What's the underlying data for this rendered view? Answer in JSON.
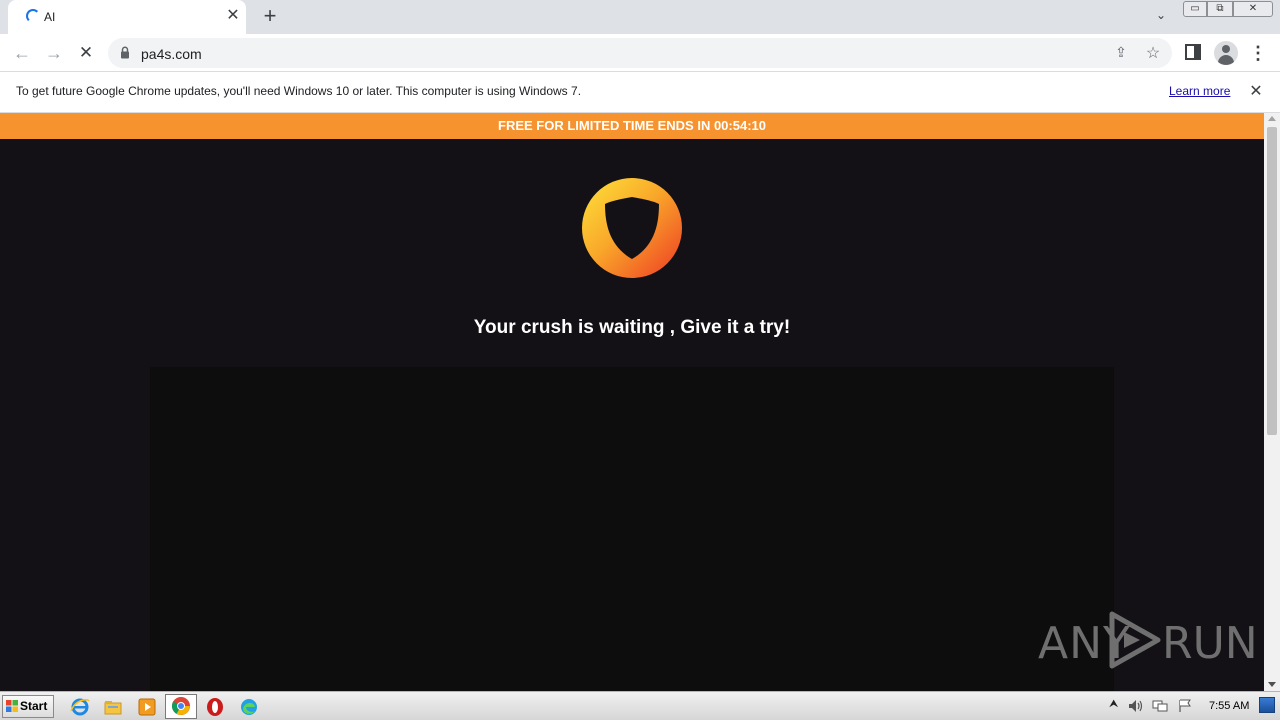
{
  "browser": {
    "tab": {
      "title": "AI",
      "close_glyph": "✕"
    },
    "new_tab_glyph": "+",
    "tab_search_glyph": "⌄",
    "window_controls": {
      "minimize": "▭",
      "maximize": "⧉",
      "close": "✕"
    },
    "nav": {
      "back_glyph": "←",
      "forward_glyph": "→",
      "stop_glyph": "✕"
    },
    "address": {
      "url": "pa4s.com"
    },
    "toolbar_glyphs": {
      "share": "⇪",
      "star": "☆",
      "menu": "⋮"
    }
  },
  "infobar": {
    "message": "To get future Google Chrome updates, you'll need Windows 10 or later. This computer is using Windows 7.",
    "link_label": "Learn more",
    "close_glyph": "✕"
  },
  "page": {
    "promo_text": "FREE FOR LIMITED TIME ENDS IN 00:54:10",
    "headline": "Your crush is waiting , Give it a try!",
    "colors": {
      "promo_bar": "#f7932f",
      "background": "#141116",
      "panel": "#0d0d0e"
    }
  },
  "watermark": {
    "left": "ANY",
    "right": "RUN"
  },
  "taskbar": {
    "start_label": "Start",
    "pinned": [
      "internet-explorer-icon",
      "file-explorer-icon",
      "media-player-icon",
      "chrome-icon",
      "opera-icon",
      "edge-icon"
    ],
    "tray_arrow": "⮝",
    "clock": "7:55 AM"
  }
}
